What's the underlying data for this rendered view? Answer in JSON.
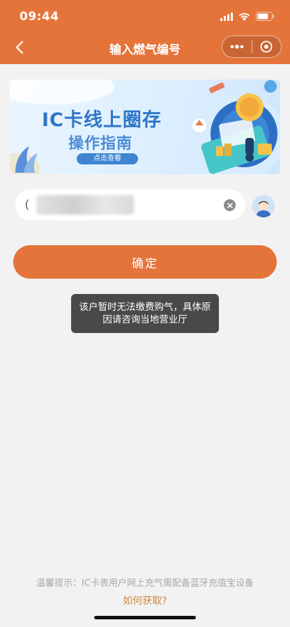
{
  "status_bar": {
    "time": "09:44"
  },
  "nav": {
    "title": "输入燃气编号"
  },
  "banner": {
    "title": "IC卡线上圈存",
    "subtitle": "操作指南",
    "button": "点击查看"
  },
  "input": {
    "value": "(",
    "placeholder": ""
  },
  "confirm_button": "确定",
  "toast": {
    "message": "该户暂时无法缴费购气，具体原因请咨询当地营业厅"
  },
  "footer": {
    "tip": "温馨提示：IC卡表用户网上充气需配备蓝牙充值宝设备",
    "link": "如何获取?"
  },
  "colors": {
    "accent": "#e5743a",
    "link": "#d0883e",
    "banner_blue": "#2f76c8"
  }
}
